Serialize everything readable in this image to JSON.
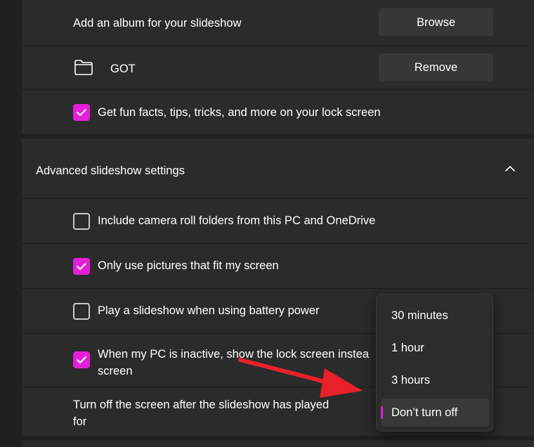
{
  "slideshow": {
    "add_album_label": "Add an album for your slideshow",
    "browse_button": "Browse",
    "album_name": "GOT",
    "remove_button": "Remove",
    "fun_facts_label": "Get fun facts, tips, tricks, and more on your lock screen",
    "fun_facts_checked": true
  },
  "advanced": {
    "header_label": "Advanced slideshow settings",
    "expanded": true,
    "options": [
      {
        "label": "Include camera roll folders from this PC and OneDrive",
        "checked": false
      },
      {
        "label": "Only use pictures that fit my screen",
        "checked": true
      },
      {
        "label": "Play a slideshow when using battery power",
        "checked": false
      },
      {
        "label_line1": "When my PC is inactive, show the lock screen instea",
        "label_line2": "screen",
        "checked": true
      }
    ],
    "turn_off_label_line1": "Turn off the screen after the slideshow has played",
    "turn_off_label_line2": "for"
  },
  "dropdown": {
    "items": [
      "30 minutes",
      "1 hour",
      "3 hours",
      "Don’t turn off"
    ],
    "selected": "Don’t turn off"
  },
  "colors": {
    "accent": "#e41fd8",
    "annotation_arrow": "#e8202a",
    "card_bg": "#2b2b2b",
    "page_bg": "#202020"
  },
  "icons": {
    "folder": "folder-icon",
    "chevron": "chevron-up-icon",
    "check": "checkmark-icon",
    "annotation": "red-arrow-annotation"
  }
}
